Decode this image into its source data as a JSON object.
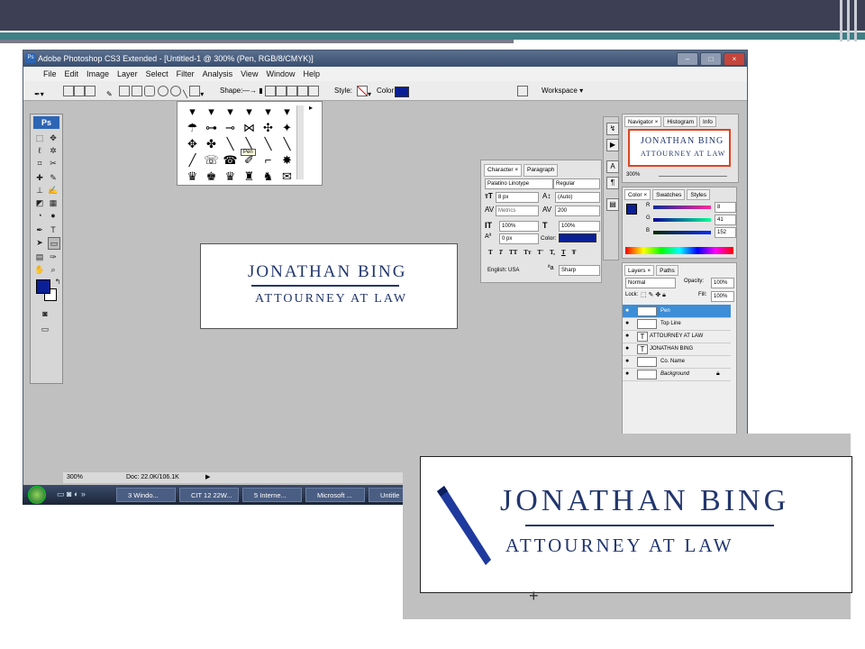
{
  "window": {
    "title": "Adobe Photoshop CS3 Extended - [Untitled-1 @ 300% (Pen, RGB/8/CMYK)]",
    "controls": [
      "–",
      "□",
      "×"
    ]
  },
  "menu": [
    "File",
    "Edit",
    "Image",
    "Layer",
    "Select",
    "Filter",
    "Analysis",
    "View",
    "Window",
    "Help"
  ],
  "options_bar": {
    "shape_label": "Shape:",
    "style_label": "Style:",
    "color_label": "Color:",
    "workspace_label": "Workspace ▾",
    "color_hex": "#0b1f94"
  },
  "toolbox": {
    "title": "Ps",
    "fg_color": "#0b1f94",
    "bg_color": "#ffffff"
  },
  "shape_picker": {
    "tooltip": "Pen",
    "glyphs": [
      "▾",
      "▾",
      "▾",
      "▾",
      "▾",
      "▾",
      "☂",
      "⊶",
      "⊸",
      "⋈",
      "✣",
      "✦",
      "✥",
      "✤",
      "╲",
      "╲",
      "╲",
      "╲",
      "╱",
      "☏",
      "☎",
      "✐",
      "⌐",
      "✸",
      "♛",
      "♚",
      "♛",
      "♜",
      "♞",
      "✉"
    ]
  },
  "document": {
    "line1": "JONATHAN BING",
    "line2": "ATTOURNEY AT LAW"
  },
  "status": {
    "zoom": "300%",
    "doc": "Doc: 22.0K/106.1K"
  },
  "character_panel": {
    "tabs": [
      "Character ×",
      "Paragraph"
    ],
    "font": "Palatino Linotype",
    "style": "Regular",
    "size": "8 px",
    "leading": "(Auto)",
    "kerning": "Metrics",
    "tracking": "200",
    "vscale": "100%",
    "hscale": "100%",
    "baseline": "0 px",
    "color_label": "Color:",
    "text_buttons": [
      "T",
      "T",
      "TT",
      "Tт",
      "T'",
      "T,",
      "T",
      "Ŧ"
    ],
    "language": "English: USA",
    "aa_label": "ªa",
    "antialias": "Sharp",
    "text_color": "#0b1f94"
  },
  "navigator": {
    "tabs": [
      "Navigator ×",
      "Histogram",
      "Info"
    ],
    "zoom": "300%"
  },
  "color_panel": {
    "tabs": [
      "Color ×",
      "Swatches",
      "Styles"
    ],
    "r": "8",
    "g": "41",
    "b": "152",
    "labels": [
      "R",
      "G",
      "B"
    ]
  },
  "layers_panel": {
    "tabs": [
      "Layers ×",
      "Paths"
    ],
    "blend": "Normal",
    "opacity_label": "Opacity:",
    "opacity": "100%",
    "lock_label": "Lock:",
    "fill_label": "Fill:",
    "fill": "100%",
    "layers": [
      "Pen",
      "Top Line",
      "ATTOURNEY AT LAW",
      "JONATHAN BING",
      "Co. Name",
      "Background"
    ]
  },
  "taskbar": {
    "tasks": [
      "3 Windo...",
      "CIT 12 22W...",
      "5 Interne...",
      "Microsoft ...",
      "Untitle"
    ]
  },
  "zoom_inset": {
    "line1": "JONATHAN BING",
    "line2": "ATTOURNEY AT LAW"
  }
}
